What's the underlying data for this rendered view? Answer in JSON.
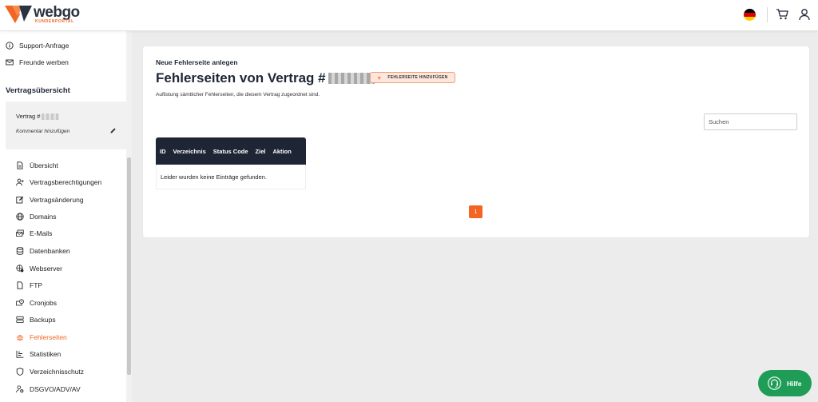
{
  "brand": {
    "name": "webgo",
    "tagline": "KUNDENPORTAL",
    "accent": "#f26522",
    "dark": "#1e2636"
  },
  "header": {
    "language_icon": "flag-de-icon",
    "cart_icon": "cart-icon",
    "user_icon": "user-icon"
  },
  "sidebar": {
    "top_links": [
      {
        "label": "Support-Anfrage",
        "icon": "info-circle-icon"
      },
      {
        "label": "Freunde werben",
        "icon": "mail-icon"
      }
    ],
    "section_title": "Vertragsübersicht",
    "contract": {
      "label": "Vertrag #",
      "comment_label": "Kommentar hinzufügen"
    },
    "items": [
      {
        "label": "Übersicht",
        "icon": "file-icon"
      },
      {
        "label": "Vertragsberechtigungen",
        "icon": "user-plus-icon"
      },
      {
        "label": "Vertragsänderung",
        "icon": "edit-icon"
      },
      {
        "label": "Domains",
        "icon": "globe-icon"
      },
      {
        "label": "E-Mails",
        "icon": "mails-icon"
      },
      {
        "label": "Datenbanken",
        "icon": "database-icon"
      },
      {
        "label": "Webserver",
        "icon": "webserver-icon"
      },
      {
        "label": "FTP",
        "icon": "document-icon"
      },
      {
        "label": "Cronjobs",
        "icon": "cronjob-icon"
      },
      {
        "label": "Backups",
        "icon": "server-icon"
      },
      {
        "label": "Fehlerseiten",
        "icon": "bug-icon",
        "active": true
      },
      {
        "label": "Statistiken",
        "icon": "chart-icon"
      },
      {
        "label": "Verzeichnisschutz",
        "icon": "shield-icon"
      },
      {
        "label": "DSGVO/ADV/AV",
        "icon": "person-gear-icon"
      }
    ]
  },
  "main": {
    "subtitle": "Neue Fehlerseite anlegen",
    "title": "Fehlerseiten von Vertrag #",
    "add_button": "FEHLERSEITE HINZUFÜGEN",
    "description": "Auflistung sämtlicher Fehlerseiten, die diesem Vertrag zugeordnet sind.",
    "search": {
      "placeholder": "Suchen",
      "value": ""
    },
    "table": {
      "columns": [
        "ID",
        "Verzeichnis",
        "Status Code",
        "Ziel",
        "Aktion"
      ],
      "empty_message": "Leider wurden keine Einträge gefunden."
    },
    "pagination": {
      "current_page": "1"
    }
  },
  "help_button": {
    "label": "Hilfe",
    "icon": "headset-icon"
  }
}
